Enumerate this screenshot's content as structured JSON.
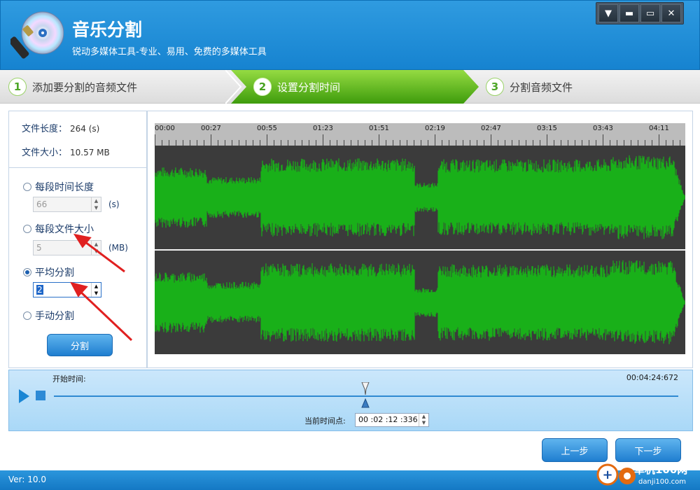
{
  "app": {
    "title": "音乐分割",
    "subtitle": "锐动多媒体工具-专业、易用、免费的多媒体工具"
  },
  "window_controls": [
    "dropdown-icon",
    "minimize-icon",
    "maximize-icon",
    "close-icon"
  ],
  "steps": [
    {
      "num": "1",
      "label": "添加要分割的音频文件",
      "active": false
    },
    {
      "num": "2",
      "label": "设置分割时间",
      "active": true
    },
    {
      "num": "3",
      "label": "分割音频文件",
      "active": false
    }
  ],
  "file_info": {
    "length_label": "文件长度：",
    "length_value": "264 (s)",
    "size_label": "文件大小：",
    "size_value": "10.57 MB"
  },
  "options": {
    "by_time": {
      "label": "每段时间长度",
      "value": "66",
      "unit": "(s)",
      "selected": false
    },
    "by_size": {
      "label": "每段文件大小",
      "value": "5",
      "unit": "(MB)",
      "selected": false
    },
    "average": {
      "label": "平均分割",
      "value": "2",
      "selected": true
    },
    "manual": {
      "label": "手动分割",
      "selected": false
    }
  },
  "split_button": "分割",
  "timeline": {
    "ticks": [
      "00:00",
      "00:27",
      "00:55",
      "01:23",
      "01:51",
      "02:19",
      "02:47",
      "03:15",
      "03:43",
      "04:11"
    ]
  },
  "player": {
    "start_label": "开始时间:",
    "total_time": "00:04:24:672",
    "current_label": "当前时间点:",
    "current_time": "00 :02 :12 :336",
    "position_fraction": 0.5
  },
  "nav": {
    "prev": "上一步",
    "next": "下一步"
  },
  "status": {
    "version": "Ver: 10.0"
  },
  "watermark": {
    "text": "单机100网",
    "url": "danji100.com"
  },
  "colors": {
    "accent": "#1683d0",
    "step_active": "#5cb524",
    "waveform": "#19b019",
    "waveform_bg": "#3b3b3b",
    "annotation_arrow": "#e02020"
  }
}
